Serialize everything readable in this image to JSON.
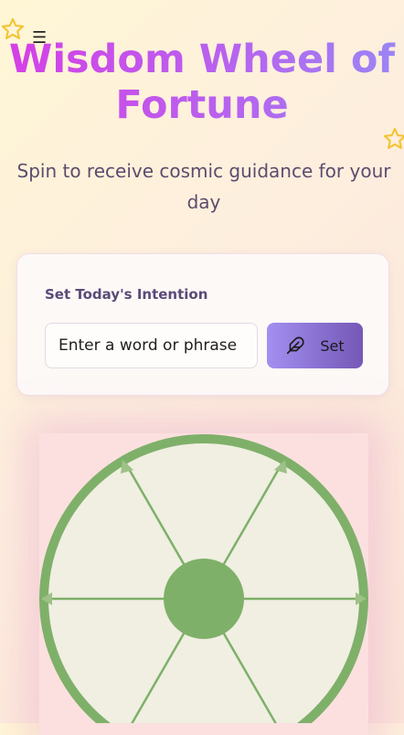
{
  "header": {
    "title": "Wisdom Wheel of Fortune",
    "subtitle": "Spin to receive cosmic guidance for your day",
    "menu_icon": "hamburger-menu-icon"
  },
  "intention": {
    "label": "Set Today's Intention",
    "input_placeholder": "Enter a word or phrase",
    "input_value": "",
    "button_label": "Set",
    "button_icon": "feather-icon"
  },
  "decorations": {
    "star_icon": "star-icon"
  },
  "colors": {
    "title_gradient_start": "#d63ee6",
    "title_gradient_end": "#9a86f5",
    "wheel_rim": "#7fb069",
    "wheel_face": "#f0efe2",
    "button_gradient_start": "#a48ff0",
    "button_gradient_end": "#7658b6",
    "star": "#f4c430"
  }
}
